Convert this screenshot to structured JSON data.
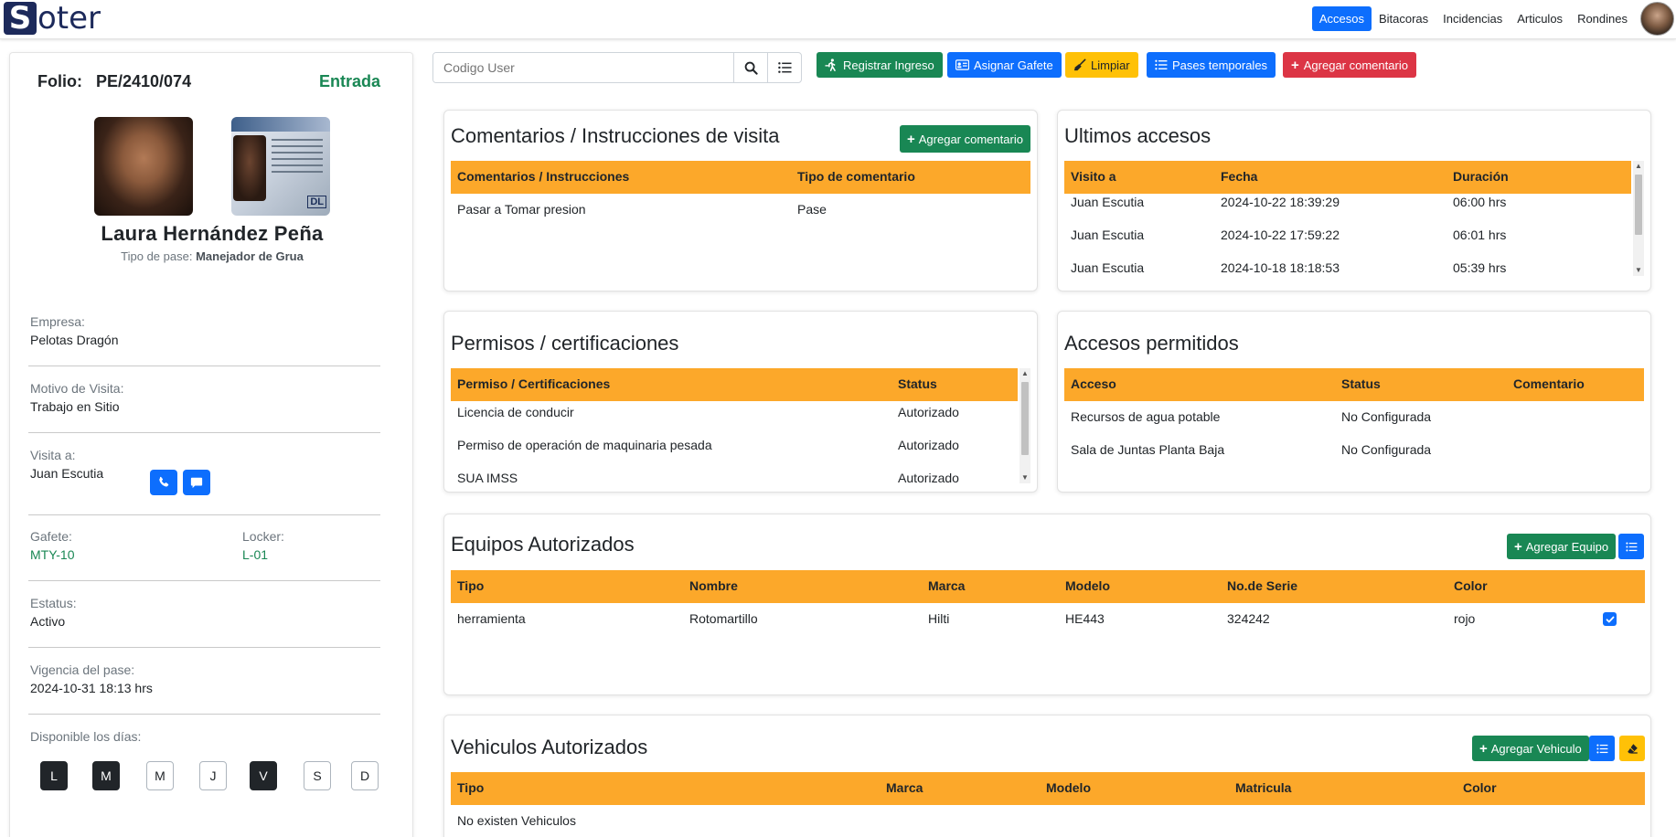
{
  "brand": {
    "mark": "S",
    "rest": "oter"
  },
  "nav": {
    "items": [
      "Accesos",
      "Bitacoras",
      "Incidencias",
      "Articulos",
      "Rondines"
    ],
    "active": "Accesos"
  },
  "pass": {
    "folio_label": "Folio:",
    "folio": "PE/2410/074",
    "movement": "Entrada",
    "name": "Laura Hernández Peña",
    "pass_type_label": "Tipo de pase:",
    "pass_type": "Manejador de Grua",
    "empresa_label": "Empresa:",
    "empresa": "Pelotas Dragón",
    "motivo_label": "Motivo de Visita:",
    "motivo": "Trabajo en Sitio",
    "visita_label": "Visita a:",
    "visita": "Juan Escutia",
    "gafete_label": "Gafete:",
    "gafete": "MTY-10",
    "locker_label": "Locker:",
    "locker": "L-01",
    "estatus_label": "Estatus:",
    "estatus": "Activo",
    "vigencia_label": "Vigencia del pase:",
    "vigencia": "2024-10-31 18:13 hrs",
    "dias_label": "Disponible los días:",
    "days": [
      {
        "label": "L",
        "on": true
      },
      {
        "label": "M",
        "on": true
      },
      {
        "label": "M",
        "on": false
      },
      {
        "label": "J",
        "on": false
      },
      {
        "label": "V",
        "on": true
      },
      {
        "label": "S",
        "on": false
      },
      {
        "label": "D",
        "on": false
      }
    ],
    "id_card_text": "DL"
  },
  "toolbar": {
    "search_placeholder": "Codigo User",
    "registrar": "Registrar Ingreso",
    "asignar": "Asignar Gafete",
    "limpiar": "Limpiar",
    "pases": "Pases temporales",
    "agregar_comentario": "Agregar comentario"
  },
  "comentarios": {
    "title": "Comentarios / Instrucciones de visita",
    "button": "Agregar comentario",
    "headers": [
      "Comentarios / Instrucciones",
      "Tipo de comentario"
    ],
    "rows": [
      [
        "Pasar a Tomar presion",
        "Pase"
      ]
    ]
  },
  "ultimos": {
    "title": "Ultimos accesos",
    "headers": [
      "Visito a",
      "Fecha",
      "Duración"
    ],
    "rows": [
      [
        "Juan Escutia",
        "2024-10-22 18:39:29",
        "06:00 hrs"
      ],
      [
        "Juan Escutia",
        "2024-10-22 17:59:22",
        "06:01 hrs"
      ],
      [
        "Juan Escutia",
        "2024-10-18 18:18:53",
        "05:39 hrs"
      ]
    ]
  },
  "permisos": {
    "title": "Permisos / certificaciones",
    "headers": [
      "Permiso / Certificaciones",
      "Status"
    ],
    "rows": [
      [
        "Licencia de conducir",
        "Autorizado"
      ],
      [
        "Permiso de operación de maquinaria pesada",
        "Autorizado"
      ],
      [
        "SUA IMSS",
        "Autorizado"
      ]
    ]
  },
  "accesos": {
    "title": "Accesos permitidos",
    "headers": [
      "Acceso",
      "Status",
      "Comentario"
    ],
    "rows": [
      [
        "Recursos de agua potable",
        "No Configurada",
        ""
      ],
      [
        "Sala de Juntas Planta Baja",
        "No Configurada",
        ""
      ]
    ]
  },
  "equipos": {
    "title": "Equipos Autorizados",
    "button": "Agregar Equipo",
    "headers": [
      "Tipo",
      "Nombre",
      "Marca",
      "Modelo",
      "No.de Serie",
      "Color"
    ],
    "rows": [
      [
        "herramienta",
        "Rotomartillo",
        "Hilti",
        "HE443",
        "324242",
        "rojo"
      ]
    ],
    "checked": [
      true
    ]
  },
  "vehiculos": {
    "title": "Vehiculos Autorizados",
    "button": "Agregar Vehiculo",
    "headers": [
      "Tipo",
      "Marca",
      "Modelo",
      "Matricula",
      "Color"
    ],
    "empty": "No existen Vehiculos"
  },
  "colors": {
    "header": "#fca82a",
    "primary": "#0d6efd",
    "success": "#198754",
    "warning": "#ffc107",
    "danger": "#dc3545"
  }
}
